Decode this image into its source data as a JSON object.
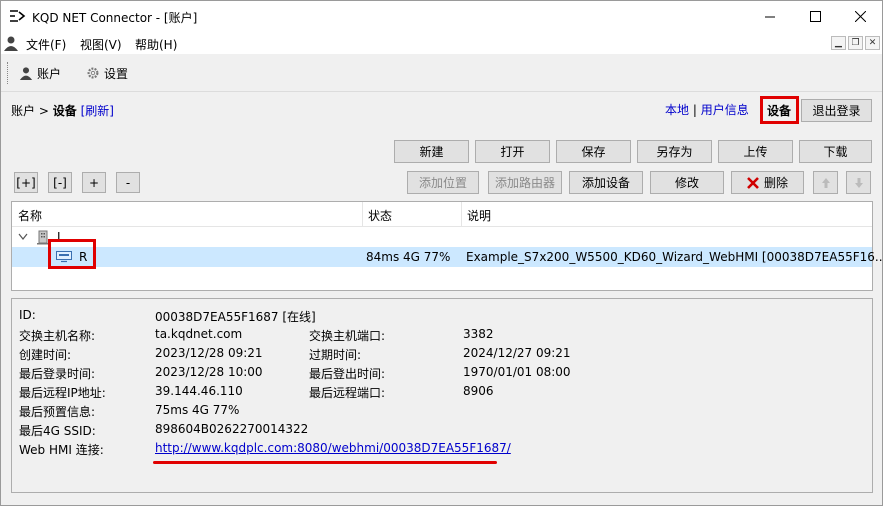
{
  "window": {
    "title": "KQD NET Connector - [账户]"
  },
  "menu": {
    "file": "文件(F)",
    "view": "视图(V)",
    "help": "帮助(H)"
  },
  "toolbar": {
    "account": "账户",
    "settings": "设置"
  },
  "breadcrumb": {
    "root": "账户",
    "sep": ">",
    "current": "设备",
    "refresh": "[刷新]"
  },
  "links": {
    "local": "本地",
    "sep": "|",
    "userinfo": "用户信息"
  },
  "buttons": {
    "device": "设备",
    "logout": "退出登录",
    "new": "新建",
    "open": "打开",
    "save": "保存",
    "saveas": "另存为",
    "upload": "上传",
    "download": "下载",
    "expand": "[+]",
    "collapse": "[-]",
    "plus": "+",
    "minus": "-",
    "addpos": "添加位置",
    "addrouter": "添加路由器",
    "adddevice": "添加设备",
    "edit": "修改",
    "delete": "删除"
  },
  "grid": {
    "columns": [
      "名称",
      "状态",
      "说明"
    ],
    "group": {
      "name": "I"
    },
    "device": {
      "name": "R",
      "status": "84ms 4G 77%",
      "desc": "Example_S7x200_W5500_KD60_Wizard_WebHMI [00038D7EA55F16..."
    }
  },
  "details": {
    "id_label": "ID:",
    "id_value": "00038D7EA55F1687 [在线]",
    "host_label": "交换主机名称:",
    "host_value": "ta.kqdnet.com",
    "port_label": "交换主机端口:",
    "port_value": "3382",
    "created_label": "创建时间:",
    "created_value": "2023/12/28 09:21",
    "expire_label": "过期时间:",
    "expire_value": "2024/12/27 09:21",
    "lastlogin_label": "最后登录时间:",
    "lastlogin_value": "2023/12/28 10:00",
    "lastlogout_label": "最后登出时间:",
    "lastlogout_value": "1970/01/01 08:00",
    "remoteip_label": "最后远程IP地址:",
    "remoteip_value": "39.144.46.110",
    "remoteport_label": "最后远程端口:",
    "remoteport_value": "8906",
    "signal_label": "最后预置信息:",
    "signal_value": "75ms 4G 77%",
    "ssid_label": "最后4G SSID:",
    "ssid_value": "898604B0262270014322",
    "webhmi_label": "Web HMI 连接:",
    "webhmi_value": "http://www.kqdplc.com:8080/webhmi/00038D7EA55F1687/"
  },
  "colors": {
    "highlight": "#e00000",
    "selection": "#cce8ff",
    "link": "#0000cc"
  }
}
